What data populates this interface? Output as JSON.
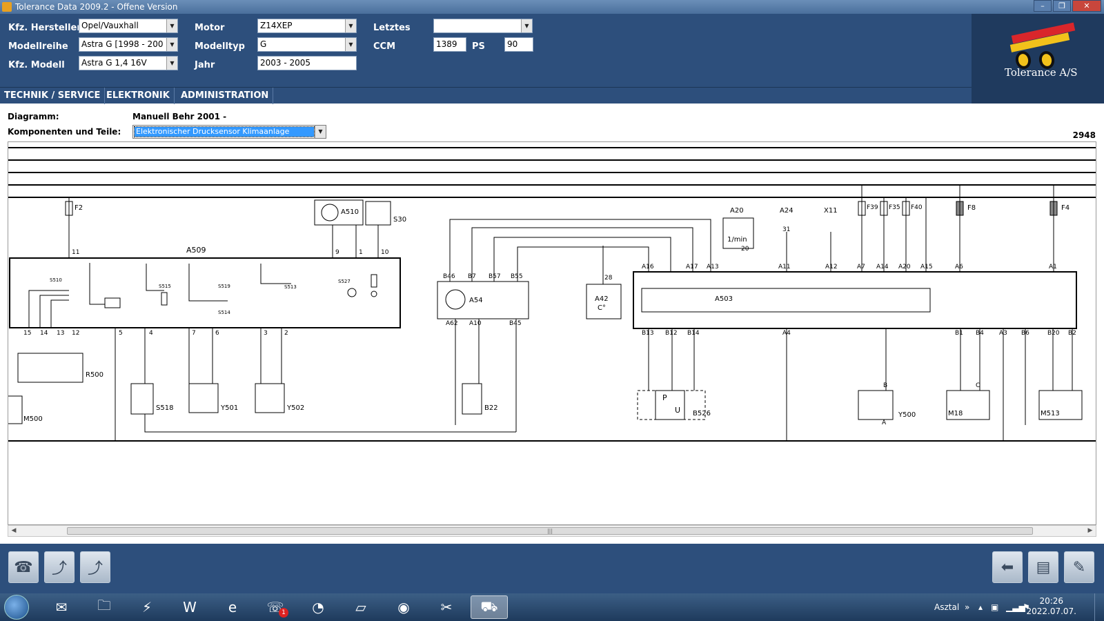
{
  "window": {
    "title": "Tolerance Data 2009.2 - Offene Version",
    "controls": [
      "–",
      "❐",
      "✕"
    ]
  },
  "header": {
    "labels": {
      "hersteller": "Kfz. Hersteller",
      "modellreihe": "Modellreihe",
      "modell": "Kfz. Modell",
      "motor": "Motor",
      "modelltyp": "Modelltyp",
      "jahr": "Jahr",
      "letztes": "Letztes",
      "ccm": "CCM",
      "ps": "PS"
    },
    "values": {
      "hersteller": "Opel/Vauxhall",
      "modellreihe": "Astra G [1998 - 200",
      "modell": "Astra G 1,4 16V",
      "motor": "Z14XEP",
      "modelltyp": "G",
      "jahr": "2003 - 2005",
      "letztes": "",
      "ccm": "1389",
      "ps": "90"
    }
  },
  "logo": {
    "brand": "Tolerance A/S"
  },
  "menu": [
    "TECHNIK / SERVICE",
    "ELEKTRONIK",
    "ADMINISTRATION"
  ],
  "diagram_info": {
    "diagramm_label": "Diagramm:",
    "diagramm_value": "Manuell Behr 2001 -",
    "komponenten_label": "Komponenten und Teile:",
    "komponenten_value": "Elektronischer Drucksensor Klimaanlage",
    "page_number": "2948"
  },
  "schematic": {
    "labels": [
      "F2",
      "A509",
      "A510",
      "S30",
      "S510",
      "S515",
      "S519",
      "S514",
      "S513",
      "S527",
      "R500",
      "M500",
      "S518",
      "Y501",
      "Y502",
      "A54",
      "B22",
      "A42",
      "C°",
      "A20",
      "1/min",
      "A24",
      "X11",
      "F39",
      "F35",
      "F40",
      "F8",
      "F4",
      "A503",
      "B526",
      "Y500",
      "M18",
      "M513",
      "P",
      "U"
    ],
    "pins": [
      "11",
      "15",
      "14",
      "13",
      "12",
      "5",
      "4",
      "7",
      "6",
      "3",
      "2",
      "9",
      "1",
      "10",
      "B46",
      "B7",
      "B57",
      "B55",
      "A62",
      "A10",
      "B45",
      "A16",
      "A17",
      "A13",
      "A11",
      "A12",
      "A7",
      "A14",
      "A20",
      "A15",
      "A6",
      "A1",
      "B13",
      "B12",
      "B14",
      "A4",
      "B1",
      "B4",
      "A3",
      "B6",
      "B20",
      "B2",
      "28",
      "20",
      "31",
      "B",
      "A",
      "C"
    ]
  },
  "scrollbar": {
    "grip": "|||"
  },
  "toolbar": {
    "left_buttons": [
      "phone-tool-icon",
      "chart-up-icon",
      "chart-up-icon"
    ],
    "right_buttons": [
      "back-arrow-icon",
      "print-icon",
      "edit-icon"
    ]
  },
  "taskbar": {
    "apps": [
      "outlook-icon",
      "explorer-icon",
      "winamp-icon",
      "word-icon",
      "ie-icon",
      "viber-icon",
      "picasa-icon",
      "notepad-icon",
      "chrome-icon",
      "paint-icon",
      "tolerance-icon"
    ],
    "viber_badge": "1",
    "lang": "Asztal",
    "time": "20:26",
    "date": "2022.07.07."
  },
  "colors": {
    "header_bg": "#2d4f7c",
    "title_bg": "#4a6f9c",
    "selection": "#3399ff"
  }
}
